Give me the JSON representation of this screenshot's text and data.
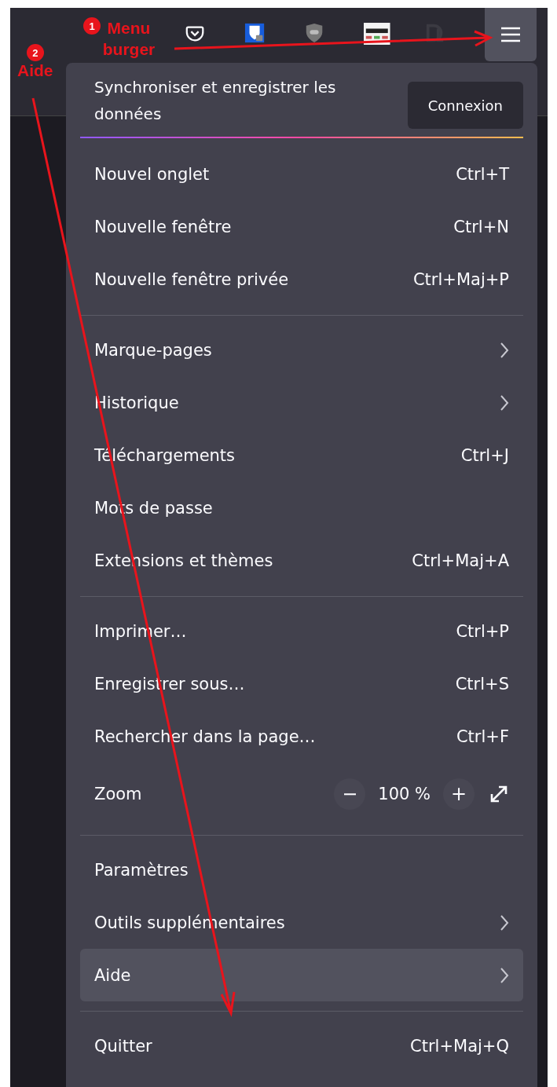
{
  "toolbar": {
    "icons": [
      {
        "kind": "pocket"
      },
      {
        "kind": "bitwarden"
      },
      {
        "kind": "ublock"
      },
      {
        "kind": "invid"
      },
      {
        "kind": "dl"
      }
    ],
    "menu_button": {
      "active": true
    }
  },
  "menu": {
    "sync": {
      "text": "Synchroniser et enregistrer les données",
      "button": "Connexion"
    },
    "items": [
      {
        "kind": "item",
        "label": "Nouvel onglet",
        "shortcut": "Ctrl+T",
        "submenu": false,
        "highlighted": false
      },
      {
        "kind": "item",
        "label": "Nouvelle fenêtre",
        "shortcut": "Ctrl+N",
        "submenu": false,
        "highlighted": false
      },
      {
        "kind": "item",
        "label": "Nouvelle fenêtre privée",
        "shortcut": "Ctrl+Maj+P",
        "submenu": false,
        "highlighted": false
      },
      {
        "kind": "separator"
      },
      {
        "kind": "item",
        "label": "Marque-pages",
        "submenu": true,
        "highlighted": false
      },
      {
        "kind": "item",
        "label": "Historique",
        "submenu": true,
        "highlighted": false
      },
      {
        "kind": "item",
        "label": "Téléchargements",
        "shortcut": "Ctrl+J",
        "submenu": false,
        "highlighted": false
      },
      {
        "kind": "item",
        "label": "Mots de passe",
        "submenu": false,
        "highlighted": false
      },
      {
        "kind": "item",
        "label": "Extensions et thèmes",
        "shortcut": "Ctrl+Maj+A",
        "submenu": false,
        "highlighted": false
      },
      {
        "kind": "separator"
      },
      {
        "kind": "item",
        "label": "Imprimer…",
        "shortcut": "Ctrl+P",
        "submenu": false,
        "highlighted": false
      },
      {
        "kind": "item",
        "label": "Enregistrer sous…",
        "shortcut": "Ctrl+S",
        "submenu": false,
        "highlighted": false
      },
      {
        "kind": "item",
        "label": "Rechercher dans la page…",
        "shortcut": "Ctrl+F",
        "submenu": false,
        "highlighted": false
      },
      {
        "kind": "zoom",
        "label": "Zoom",
        "minus": "−",
        "value": "100 %",
        "plus": "+"
      },
      {
        "kind": "separator"
      },
      {
        "kind": "item",
        "label": "Paramètres",
        "submenu": false,
        "highlighted": false
      },
      {
        "kind": "item",
        "label": "Outils supplémentaires",
        "submenu": true,
        "highlighted": false
      },
      {
        "kind": "item",
        "label": "Aide",
        "submenu": true,
        "highlighted": true
      },
      {
        "kind": "separator"
      },
      {
        "kind": "item",
        "label": "Quitter",
        "shortcut": "Ctrl+Maj+Q",
        "submenu": false,
        "highlighted": false
      }
    ]
  },
  "annotations": [
    {
      "number": "1",
      "label": "Menu burger"
    },
    {
      "number": "2",
      "label": "Aide"
    }
  ]
}
